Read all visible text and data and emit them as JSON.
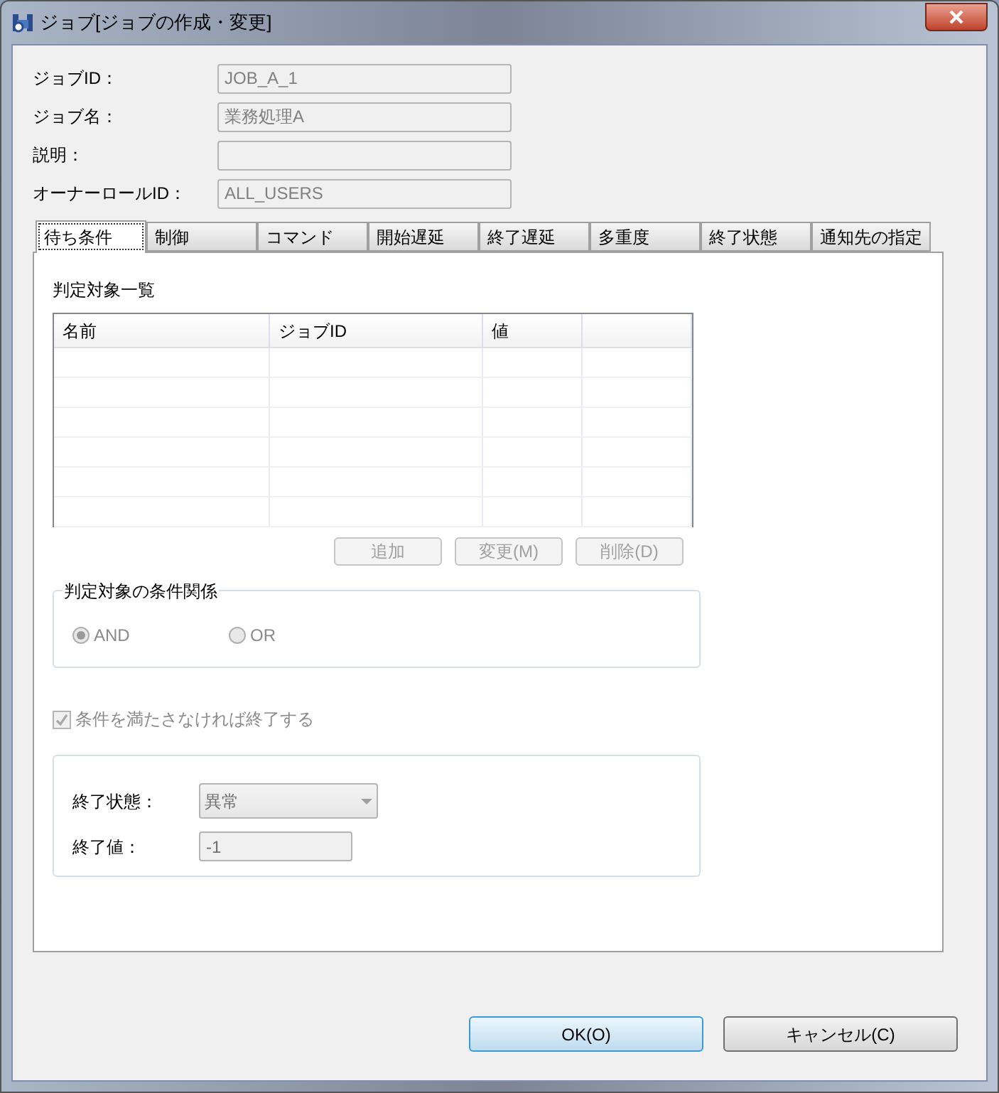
{
  "window": {
    "title": "ジョブ[ジョブの作成・変更]"
  },
  "fields": [
    {
      "label": "ジョブID：",
      "value": "JOB_A_1"
    },
    {
      "label": "ジョブ名：",
      "value": "業務処理A"
    },
    {
      "label": "説明："
    },
    {
      "label": "オーナーロールID：",
      "value": "ALL_USERS"
    }
  ],
  "tabs": [
    {
      "label": "待ち条件",
      "selected": true
    },
    {
      "label": "制御",
      "selected": false
    },
    {
      "label": "コマンド",
      "selected": false
    },
    {
      "label": "開始遅延",
      "selected": false
    },
    {
      "label": "終了遅延",
      "selected": false
    },
    {
      "label": "多重度",
      "selected": false
    },
    {
      "label": "終了状態",
      "selected": false
    },
    {
      "label": "通知先の指定",
      "selected": false
    }
  ],
  "target_list": {
    "title": "判定対象一覧",
    "columns": [
      "名前",
      "ジョブID",
      "値"
    ]
  },
  "list_buttons": [
    {
      "label": "追加",
      "disabled": true
    },
    {
      "label": "変更(M)",
      "disabled": true
    },
    {
      "label": "削除(D)",
      "disabled": true
    }
  ],
  "condition_group": {
    "title": "判定対象の条件関係",
    "disabled": true,
    "options": [
      {
        "label": "AND",
        "selected": true
      },
      {
        "label": "OR",
        "selected": false
      }
    ]
  },
  "end_checkbox": {
    "label": "条件を満たさなければ終了する",
    "checked": true,
    "disabled": true
  },
  "end_status": {
    "label": "終了状態：",
    "value": "異常"
  },
  "end_value": {
    "label": "終了値：",
    "value": "-1"
  },
  "dialog_buttons": [
    {
      "label": "OK(O)",
      "default": true
    },
    {
      "label": "キャンセル(C)",
      "default": false
    }
  ]
}
